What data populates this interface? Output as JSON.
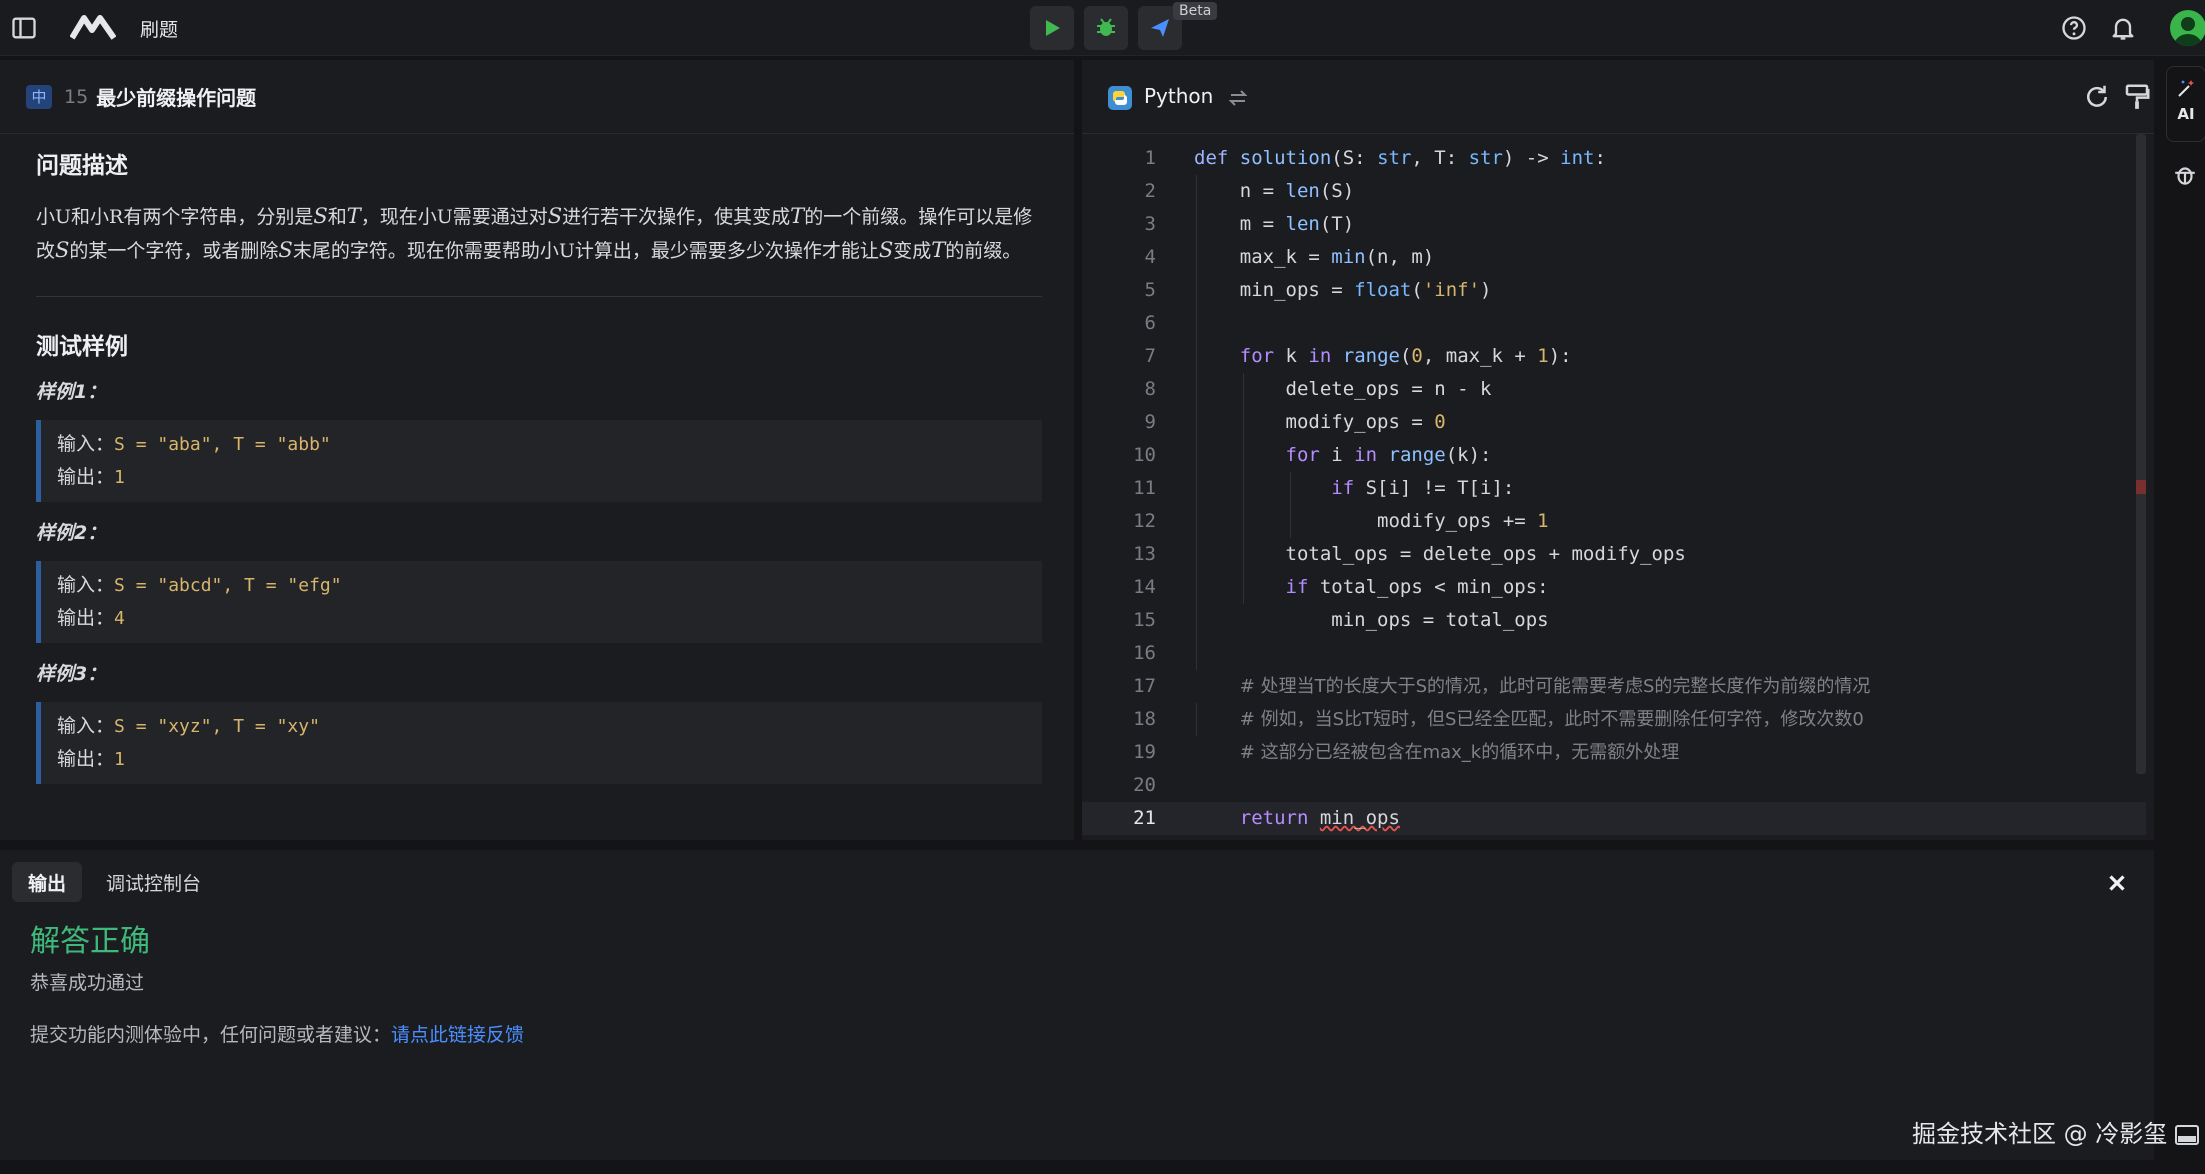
{
  "app": {
    "title": "刷题",
    "beta_badge": "Beta",
    "icons": {
      "sidebar": "sidebar-toggle-icon",
      "logo": "marscode-logo-icon",
      "run": "play-icon",
      "debug": "bug-icon",
      "submit": "send-icon",
      "help": "help-icon",
      "bell": "bell-icon",
      "avatar": "user-avatar-icon"
    },
    "colors": {
      "run": "#3fb950",
      "debug": "#3fb950",
      "submit": "#4a8fff",
      "accent": "#4a8fff",
      "success": "#3fb97b"
    }
  },
  "problem": {
    "difficulty": "中",
    "number": "15",
    "title": "最少前缀操作问题",
    "section_description": "问题描述",
    "desc_parts": {
      "p1": "小U和小R有两个字符串，分别是",
      "S1": "S",
      "and": "和",
      "T1": "T",
      "p2": "，现在小U需要通过对",
      "S2": "S",
      "p3": "进行若干次操作，使其变成",
      "T2": "T",
      "p4": "的一个前缀。操作可以是修改",
      "S3": "S",
      "p5": "的某一个字符，或者删除",
      "S4": "S",
      "p6": "末尾的字符。现在你需要帮助小U计算出，最少需要多少次操作才能让",
      "S5": "S",
      "p7": "变成",
      "T3": "T",
      "p8": "的前缀。"
    },
    "section_samples": "测试样例",
    "samples": [
      {
        "label": "样例1：",
        "input_label": "输入：",
        "input": "S = \"aba\", T = \"abb\"",
        "output_label": "输出：",
        "output": "1"
      },
      {
        "label": "样例2：",
        "input_label": "输入：",
        "input": "S = \"abcd\", T = \"efg\"",
        "output_label": "输出：",
        "output": "4"
      },
      {
        "label": "样例3：",
        "input_label": "输入：",
        "input": "S = \"xyz\", T = \"xy\"",
        "output_label": "输出：",
        "output": "1"
      }
    ]
  },
  "editor": {
    "language": "Python",
    "active_line": 21,
    "lines": [
      "def solution(S: str, T: str) -> int:",
      "    n = len(S)",
      "    m = len(T)",
      "    max_k = min(n, m)",
      "    min_ops = float('inf')",
      "",
      "    for k in range(0, max_k + 1):",
      "        delete_ops = n - k",
      "        modify_ops = 0",
      "        for i in range(k):",
      "            if S[i] != T[i]:",
      "                modify_ops += 1",
      "        total_ops = delete_ops + modify_ops",
      "        if total_ops < min_ops:",
      "            min_ops = total_ops",
      "",
      "    # 处理当T的长度大于S的情况，此时可能需要考虑S的完整长度作为前缀的情况",
      "    # 例如，当S比T短时，但S已经全匹配，此时不需要删除任何字符，修改次数0",
      "    # 这部分已经被包含在max_k的循环中，无需额外处理",
      "",
      "    return min_ops"
    ]
  },
  "rail": {
    "ai_label": "AI"
  },
  "output": {
    "tabs": [
      "输出",
      "调试控制台"
    ],
    "active_tab": "输出",
    "result_title": "解答正确",
    "result_sub": "恭喜成功通过",
    "feedback_text": "提交功能内测体验中，任何问题或者建议：",
    "feedback_link": "请点此链接反馈"
  },
  "watermark": "掘金技术社区 @ 冷影玺"
}
